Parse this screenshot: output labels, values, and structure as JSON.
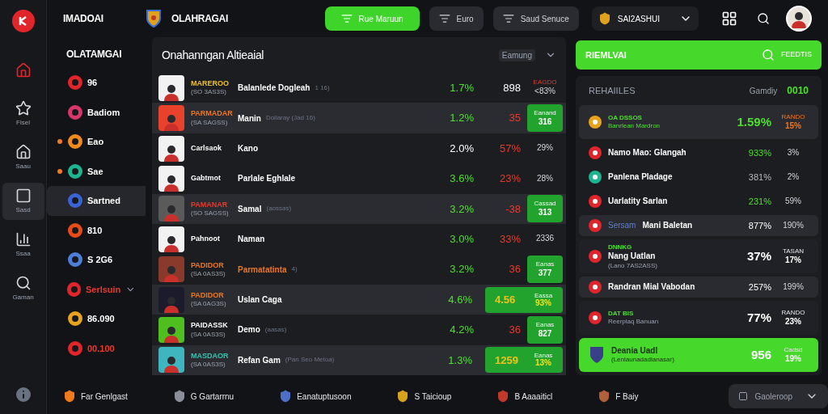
{
  "header": {
    "brand": "IMADOAI",
    "league": "OLAHRAGAI",
    "buttons": [
      {
        "label": "Rue Maruun",
        "kind": "primary"
      },
      {
        "label": "Euro",
        "kind": "secondary"
      },
      {
        "label": "Saud Senuce",
        "kind": "secondary"
      }
    ],
    "account": "SAI2ASHUI"
  },
  "rail": [
    {
      "selected": false
    },
    {
      "label": "Fisel",
      "selected": false
    },
    {
      "label": "Saau",
      "selected": false
    },
    {
      "label": "Sasd",
      "selected": true
    },
    {
      "label": "Ssaa",
      "selected": false
    },
    {
      "label": "Gaman",
      "selected": false
    }
  ],
  "sidebar": {
    "title": "OLATAMGAI",
    "items": [
      {
        "label": "96",
        "color": "#e0252b",
        "live": false,
        "kind": "link",
        "alert": false,
        "selected": false
      },
      {
        "label": "Badiom",
        "color": "#d9366a",
        "live": false,
        "kind": "link",
        "alert": false,
        "selected": false
      },
      {
        "label": "Eao",
        "color": "#f08a1c",
        "live": true,
        "kind": "link",
        "alert": false,
        "selected": false
      },
      {
        "label": "Sae",
        "color": "#1db58f",
        "live": true,
        "kind": "link",
        "alert": false,
        "selected": false
      },
      {
        "label": "Sartned",
        "color": "#3a63d6",
        "live": false,
        "kind": "link",
        "alert": false,
        "selected": true
      },
      {
        "label": "810",
        "color": "#e84a1a",
        "live": false,
        "kind": "link",
        "alert": false,
        "selected": false
      },
      {
        "label": "S 2G6",
        "color": "#4d7fd8",
        "live": false,
        "kind": "link",
        "alert": false,
        "selected": false
      },
      {
        "label": "Serlsuin",
        "color": "#e0252b",
        "live": false,
        "kind": "group",
        "alert": true,
        "selected": false
      },
      {
        "label": "86.090",
        "color": "#e8a21c",
        "live": false,
        "kind": "link",
        "alert": false,
        "selected": false
      },
      {
        "label": "00.100",
        "color": "#e0252b",
        "live": false,
        "kind": "link",
        "alert": true,
        "selected": false
      }
    ]
  },
  "table": {
    "title": "Onahanngan Altieaial",
    "sort": "Eamung",
    "rows": [
      {
        "color": "#f2f2f2",
        "tag": {
          "text": "MAREROO",
          "color": "#f1c21b"
        },
        "sub": "(SO 3AS3S)",
        "name": {
          "text": "Balanlede Dogleah",
          "color": "#ffffff"
        },
        "note": "1 16)",
        "pct": {
          "text": "1.7%",
          "color": "#4ce02a"
        },
        "odds": {
          "text": "898",
          "color": "#ffffff"
        },
        "selected": false,
        "last": {
          "kind": "text",
          "label": "EAGDO",
          "value": "<83%"
        }
      },
      {
        "color": "#e8412c",
        "tag": {
          "text": "PARMADAR",
          "color": "#f0761c"
        },
        "sub": "(SA SAGSS)",
        "name": {
          "text": "Manin",
          "color": "#ffffff"
        },
        "note": "Dollaray (Jad 16)",
        "pct": {
          "text": "1.2%",
          "color": "#4ce02a"
        },
        "odds": {
          "text": "35",
          "color": "#e8392b"
        },
        "selected": true,
        "last": {
          "kind": "box",
          "label": "Eanand",
          "value": "316"
        }
      },
      {
        "color": "#f2f2f2",
        "tag": {
          "text": "Carlsaok",
          "color": "#ffffff"
        },
        "name": {
          "text": "Kano",
          "color": "#ffffff"
        },
        "pct": {
          "text": "2.0%",
          "color": "#ffffff"
        },
        "odds": {
          "text": "57%",
          "color": "#e8392b"
        },
        "selected": false,
        "last": {
          "kind": "text",
          "value": "29%"
        }
      },
      {
        "color": "#f2f2f2",
        "tag": {
          "text": "Gabtmot",
          "color": "#ffffff"
        },
        "name": {
          "text": "Parlale Eghlale",
          "color": "#ffffff"
        },
        "pct": {
          "text": "3.6%",
          "color": "#4ce02a"
        },
        "odds": {
          "text": "23%",
          "color": "#e8392b"
        },
        "selected": false,
        "last": {
          "kind": "text",
          "value": "28%"
        }
      },
      {
        "color": "#5a5a5a",
        "tag": {
          "text": "PAMANAR",
          "color": "#e8392b"
        },
        "sub": "(SO SAGSS)",
        "name": {
          "text": "Samal",
          "color": "#ffffff"
        },
        "note": "(aossas)",
        "pct": {
          "text": "3.2%",
          "color": "#4ce02a"
        },
        "odds": {
          "text": "-38",
          "color": "#e8392b"
        },
        "selected": true,
        "last": {
          "kind": "box",
          "label": "Cassad",
          "value": "313"
        }
      },
      {
        "color": "#f2f2f2",
        "tag": {
          "text": "Pahnoot",
          "color": "#ffffff"
        },
        "name": {
          "text": "Naman",
          "color": "#ffffff"
        },
        "pct": {
          "text": "3.0%",
          "color": "#4ce02a"
        },
        "odds": {
          "text": "33%",
          "color": "#e8392b"
        },
        "selected": false,
        "last": {
          "kind": "text",
          "value": "2336"
        }
      },
      {
        "color": "#8a3a2a",
        "tag": {
          "text": "PADIDOR",
          "color": "#f0761c"
        },
        "sub": "(SA 0AS3S)",
        "name": {
          "text": "Parmatatinta",
          "color": "#f0761c"
        },
        "note": "4)",
        "pct": {
          "text": "3.2%",
          "color": "#4ce02a"
        },
        "odds": {
          "text": "36",
          "color": "#e8392b"
        },
        "selected": false,
        "last": {
          "kind": "box",
          "label": "Eanas",
          "value": "377"
        }
      },
      {
        "color": "#1b1b2b",
        "tag": {
          "text": "PADIDOR",
          "color": "#f0761c"
        },
        "sub": "(SA 0AG3S)",
        "name": {
          "text": "Uslan Caga",
          "color": "#ffffff"
        },
        "pct": {
          "text": "4.6%",
          "color": "#4ce02a"
        },
        "odds": {
          "text": "4.56",
          "color": "#f1c21b"
        },
        "selected": true,
        "last": {
          "kind": "wide",
          "label": "Eassa",
          "value": "93%"
        }
      },
      {
        "color": "#4fbf20",
        "tag": {
          "text": "PAIDASSK",
          "color": "#ffffff"
        },
        "sub": "(SA 0AS3S)",
        "name": {
          "text": "Demo",
          "color": "#ffffff"
        },
        "note": "(aasas)",
        "pct": {
          "text": "4.2%",
          "color": "#4ce02a"
        },
        "odds": {
          "text": "36",
          "color": "#e8392b"
        },
        "selected": false,
        "last": {
          "kind": "box",
          "label": "Eanas",
          "value": "827"
        }
      },
      {
        "color": "#3fb5c0",
        "tag": {
          "text": "MASDAOR",
          "color": "#2fc5b0"
        },
        "sub": "(SA 0AS3S)",
        "name": {
          "text": "Refan Gam",
          "color": "#ffffff"
        },
        "note": "(Pan Seo Metoa)",
        "pct": {
          "text": "1.3%",
          "color": "#4ce02a"
        },
        "odds": {
          "text": "1259",
          "color": "#f1c21b"
        },
        "selected": true,
        "last": {
          "kind": "wide",
          "label": "Eanas",
          "value": "13%"
        }
      }
    ]
  },
  "panel": {
    "title": "RIEMLVAI",
    "search": "FEEDTIS",
    "card_title": "REHAIILES",
    "card_sort": "Gamdiy",
    "card_count": "0010",
    "rows": [
      {
        "kind": "featured",
        "color": "#e8a21c",
        "tag": "OA DSSOS",
        "sub": "Banrlean Mardron",
        "pct": {
          "text": "1.59%",
          "color": "#4ce02a"
        },
        "side_label": "RANDO",
        "side": "15%"
      },
      {
        "kind": "plain",
        "color": "#e0252b",
        "name": "Namo Mao: Glangah",
        "pct": {
          "text": "933%",
          "color": "#4ce02a"
        },
        "side": "3%"
      },
      {
        "kind": "plain",
        "color": "#1db58f",
        "name": "Panlena Pladage",
        "pct": {
          "text": "381%",
          "color": "#b5b8bf"
        },
        "side": "2%"
      },
      {
        "kind": "plain",
        "color": "#e0252b",
        "name": "Uarlatity Sarlan",
        "pct": {
          "text": "231%",
          "color": "#4ce02a"
        },
        "side": "59%"
      },
      {
        "kind": "boxed",
        "color": "#e0252b",
        "prefix": "Sersam",
        "name": "Mani Baletan",
        "pct": {
          "text": "877%",
          "color": "#ffffff"
        },
        "side": "190%"
      },
      {
        "kind": "card",
        "color": "#e0252b",
        "tag": "DNNKG",
        "name": "Nang Uatlan",
        "sub": "(Lano 7AS2ASS)",
        "pct": {
          "text": "37%",
          "color": "#ffffff"
        },
        "side_label": "TASAN",
        "side": "17%"
      },
      {
        "kind": "boxed",
        "color": "#e0252b",
        "name": "Randran Mial Vabodan",
        "pct": {
          "text": "257%",
          "color": "#ffffff"
        },
        "side": "199%"
      },
      {
        "kind": "card",
        "color": "#e0252b",
        "tag": "DAT BIS",
        "sub": "Reerplaq Banuan",
        "pct": {
          "text": "77%",
          "color": "#ffffff"
        },
        "side_label": "RANDO",
        "side": "23%"
      },
      {
        "kind": "green",
        "color": "#3a3f8a",
        "name": "Deania Uadl",
        "sub": "(Leniaunadadianasar)",
        "pct": {
          "text": "956",
          "color": "#ffffff"
        },
        "side_label": "Cadsd",
        "side": "19%"
      }
    ]
  },
  "footer": {
    "items": [
      {
        "label": "Far Genlgast",
        "color": "#f07a1c"
      },
      {
        "label": "G Gartarrnu",
        "color": "#8a8f99"
      },
      {
        "label": "Eanatuptusoon",
        "color": "#4d6fc8"
      },
      {
        "label": "S Taicioup",
        "color": "#d9a21c"
      },
      {
        "label": "B Aaaaiticl",
        "color": "#c0392b"
      },
      {
        "label": "F Baiy",
        "color": "#b0603a"
      }
    ],
    "select": "Gaoleroop"
  }
}
